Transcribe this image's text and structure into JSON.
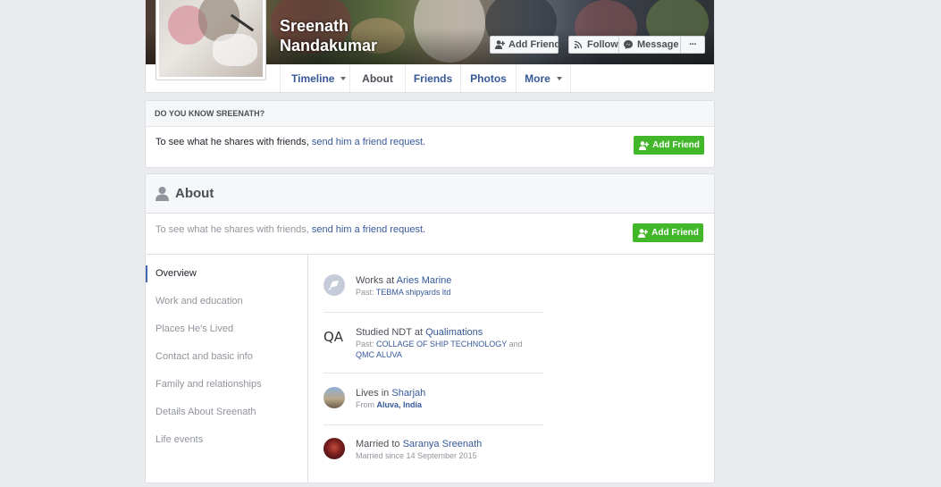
{
  "profile": {
    "name_line1": "Sreenath",
    "name_line2": "Nandakumar"
  },
  "cover_actions": {
    "add_friend": "Add Friend",
    "follow": "Follow",
    "message": "Message",
    "more": "···"
  },
  "tabs": [
    {
      "label": "Timeline",
      "caret": true
    },
    {
      "label": "About",
      "active": true
    },
    {
      "label": "Friends"
    },
    {
      "label": "Photos"
    },
    {
      "label": "More",
      "caret": true
    }
  ],
  "know": {
    "header": "DO YOU KNOW SREENATH?",
    "msg_prefix": "To see what he shares with friends, ",
    "msg_link": "send him a friend request.",
    "button": "Add Friend"
  },
  "about": {
    "title": "About",
    "msg_prefix": "To see what he shares with friends, ",
    "msg_link": "send him a friend request.",
    "button": "Add Friend",
    "nav": [
      {
        "label": "Overview",
        "active": true
      },
      {
        "label": "Work and education"
      },
      {
        "label": "Places He's Lived"
      },
      {
        "label": "Contact and basic info"
      },
      {
        "label": "Family and relationships"
      },
      {
        "label": "Details About Sreenath"
      },
      {
        "label": "Life events"
      }
    ],
    "overview": {
      "work": {
        "prefix": "Works at ",
        "link": "Aries Marine",
        "past_prefix": "Past: ",
        "past_link": "TEBMA shipyards ltd"
      },
      "education": {
        "icon_text": "QA",
        "prefix": "Studied NDT at ",
        "link": "Qualimations",
        "past_prefix": "Past: ",
        "past_link1": "COLLAGE OF SHIP TECHNOLOGY",
        "and": " and ",
        "past_link2": "QMC ALUVA"
      },
      "lives": {
        "prefix": "Lives in ",
        "link": "Sharjah",
        "from_prefix": "From ",
        "from_link": "Aluva, India"
      },
      "married": {
        "prefix": "Married to ",
        "link": "Saranya Sreenath",
        "meta": "Married since 14 September 2015"
      }
    }
  },
  "colors": {
    "background": "#e9ebee",
    "link": "#365899",
    "green": "#42b72a",
    "nav_active_bar": "#4267b2"
  }
}
